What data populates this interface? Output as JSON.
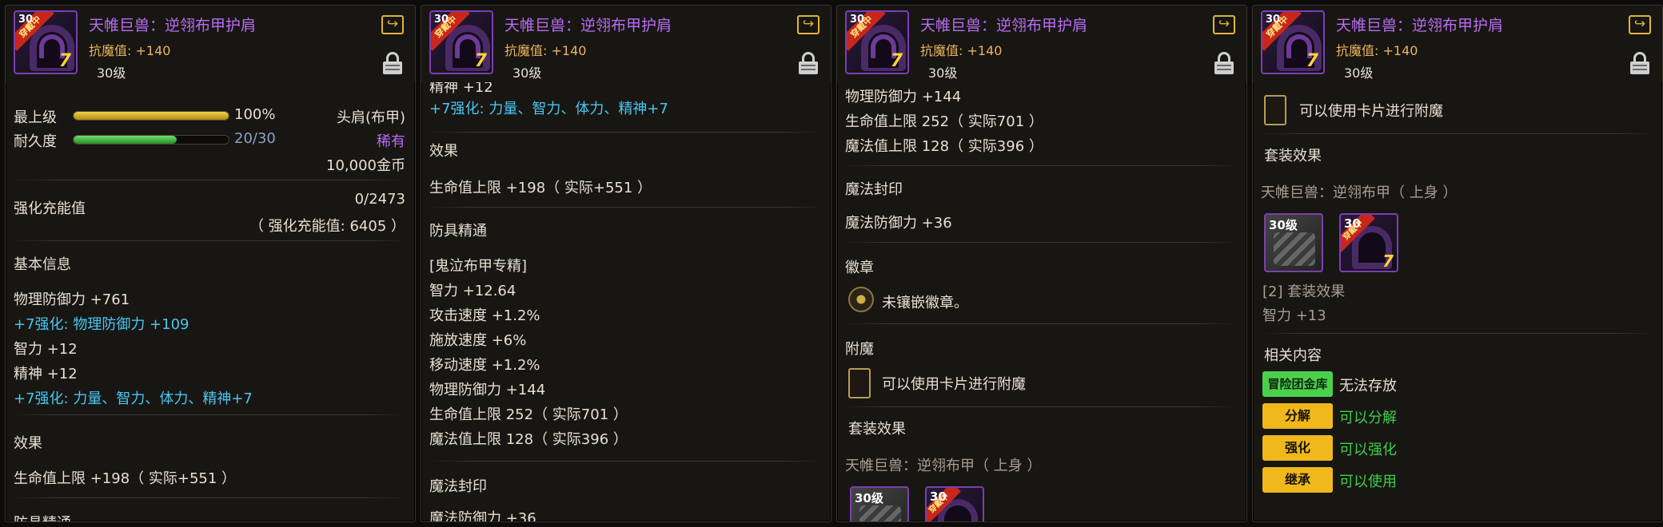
{
  "item": {
    "name": "天帷巨兽：逆翎布甲护肩",
    "stat_line": "抗魔值: +140",
    "level": "30级",
    "icon_level": "30",
    "icon_banner": "穿戴中",
    "icon_plus": "7"
  },
  "bars": {
    "grade_label": "最上级",
    "grade_value": "100%",
    "grade_fraction": 1.0,
    "durability_label": "耐久度",
    "durability_value": "20/30",
    "durability_fraction": 0.667,
    "slot_type": "头肩(布甲)",
    "rarity": "稀有",
    "price": "10,000金币"
  },
  "reinforce": {
    "label": "强化充能值",
    "value": "0/2473",
    "detail": "（ 强化充能值: 6405 ）"
  },
  "basic": {
    "title": "基本信息",
    "lines": [
      "物理防御力 +761",
      "+7强化: 物理防御力 +109",
      "智力 +12",
      "精神 +12",
      "+7强化: 力量、智力、体力、精神+7"
    ]
  },
  "effect": {
    "title": "效果",
    "line": "生命值上限 +198（ 实际+551 ）"
  },
  "mastery": {
    "title": "防具精通",
    "lines": [
      "[鬼泣布甲专精]",
      "智力 +12.64",
      "攻击速度 +1.2%",
      "施放速度 +6%",
      "移动速度 +1.2%",
      "物理防御力 +144",
      "生命值上限 252（ 实际701 ）",
      "魔法值上限 128（ 实际396 ）"
    ],
    "partial_top": "精神 +12"
  },
  "seal": {
    "title": "魔法封印",
    "line": "魔法防御力 +36"
  },
  "badge": {
    "title": "徽章",
    "line": "未镶嵌徽章。"
  },
  "enchant": {
    "title": "附魔",
    "line": "可以使用卡片进行附魔"
  },
  "set": {
    "title": "套装效果",
    "name": "天帷巨兽：逆翎布甲（ 上身 ）",
    "icon1_level": "30级",
    "icon2_level": "30",
    "bonus_title": "[2] 套装效果",
    "bonus_line": "智力 +13"
  },
  "related": {
    "title": "相关内容",
    "items": [
      {
        "tag": "冒险团金库",
        "value": "无法存放"
      },
      {
        "tag": "分解",
        "value": "可以分解"
      },
      {
        "tag": "强化",
        "value": "可以强化"
      },
      {
        "tag": "继承",
        "value": "可以使用"
      }
    ]
  },
  "colors": {
    "epic_purple": "#b76cf2",
    "reinforce_cyan": "#49c6f0",
    "positive_green": "#3ad04a",
    "tag_yellow": "#f0b81a"
  }
}
